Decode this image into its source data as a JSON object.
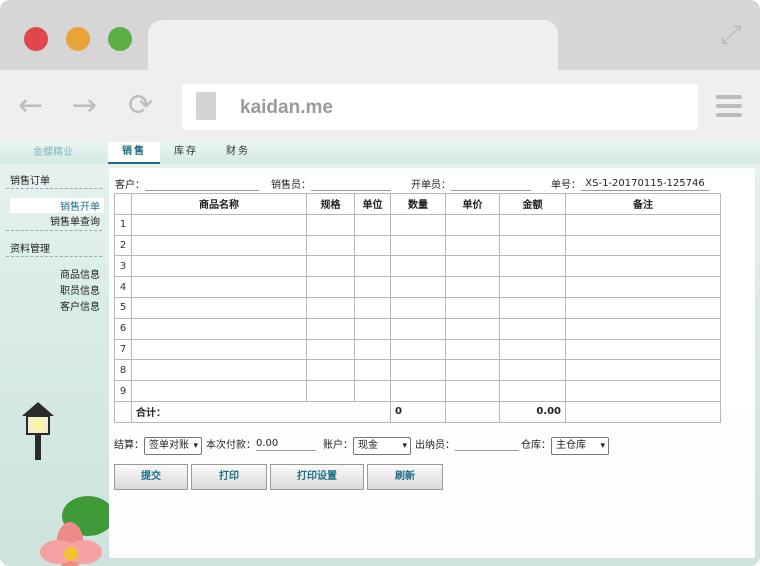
{
  "browser": {
    "url": "kaidan.me"
  },
  "app": {
    "brand": "金蝶精业",
    "tabs": [
      "销售",
      "库存",
      "财务"
    ],
    "active_tab": 0
  },
  "sidebar": {
    "groups": [
      {
        "label": "销售订单",
        "items": [
          "销售开单",
          "销售单查询"
        ]
      },
      {
        "label": "资料管理",
        "items": [
          "商品信息",
          "职员信息",
          "客户信息"
        ]
      }
    ],
    "active_item": "销售开单"
  },
  "form_header": {
    "customer_label": "客户：",
    "customer_value": "",
    "salesperson_label": "销售员：",
    "salesperson_value": "",
    "issuer_label": "开单员：",
    "issuer_value": "",
    "order_no_label": "单号：",
    "order_no_value": "XS-1-20170115-125746"
  },
  "table": {
    "columns": [
      "",
      "商品名称",
      "规格",
      "单位",
      "数量",
      "单价",
      "金额",
      "备注"
    ],
    "rows": [
      [
        "1",
        "",
        "",
        "",
        "",
        "",
        "",
        ""
      ],
      [
        "2",
        "",
        "",
        "",
        "",
        "",
        "",
        ""
      ],
      [
        "3",
        "",
        "",
        "",
        "",
        "",
        "",
        ""
      ],
      [
        "4",
        "",
        "",
        "",
        "",
        "",
        "",
        ""
      ],
      [
        "5",
        "",
        "",
        "",
        "",
        "",
        "",
        ""
      ],
      [
        "6",
        "",
        "",
        "",
        "",
        "",
        "",
        ""
      ],
      [
        "7",
        "",
        "",
        "",
        "",
        "",
        "",
        ""
      ],
      [
        "8",
        "",
        "",
        "",
        "",
        "",
        "",
        ""
      ],
      [
        "9",
        "",
        "",
        "",
        "",
        "",
        "",
        ""
      ]
    ],
    "total_label": "合计：",
    "total_quantity": "0",
    "total_amount": "0.00"
  },
  "form_footer": {
    "settlement_label": "结算：",
    "settlement_value": "签单对账",
    "payment_label": "本次付款：",
    "payment_value": "0.00",
    "account_label": "账户：",
    "account_value": "现金",
    "cashier_label": "出纳员：",
    "cashier_value": "",
    "warehouse_label": "仓库：",
    "warehouse_value": "主仓库"
  },
  "buttons": {
    "submit": "提交",
    "print": "打印",
    "print_settings": "打印设置",
    "refresh": "刷新"
  },
  "colors": {
    "accent": "#1e6f86",
    "red_light": "#e0474c",
    "yellow_light": "#e9a33b",
    "green_light": "#5aae43"
  }
}
